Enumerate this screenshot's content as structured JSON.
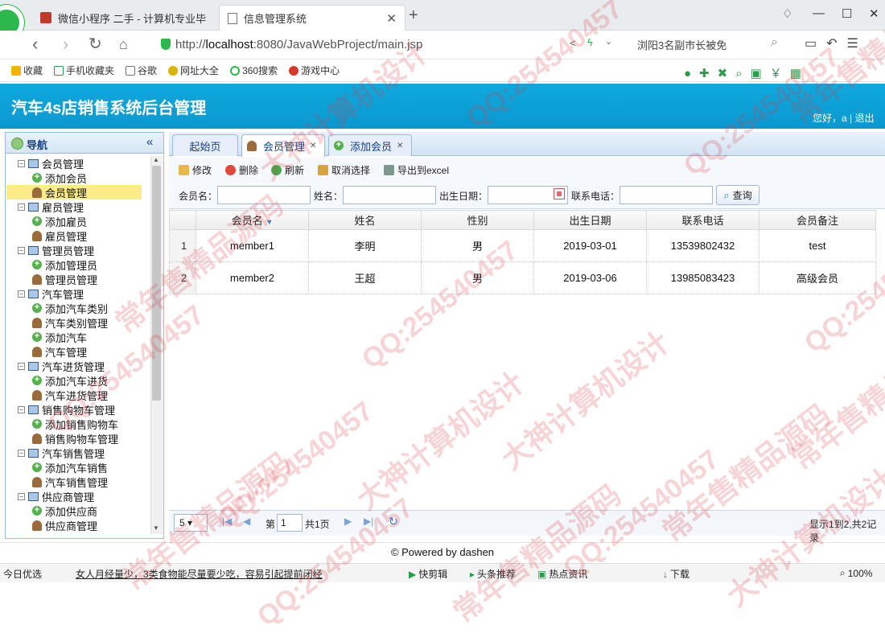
{
  "browser": {
    "tabs": [
      {
        "title": "微信小程序 二手 - 计算机专业毕"
      },
      {
        "title": "信息管理系统"
      }
    ],
    "url_prefix": "http://",
    "url_host": "localhost",
    "url_rest": ":8080/JavaWebProject/main.jsp",
    "news_text": "浏阳3名副市长被免",
    "bookmarks": [
      "收藏",
      "手机收藏夹",
      "谷歌",
      "网址大全",
      "360搜索",
      "游戏中心"
    ]
  },
  "app": {
    "title": "汽车4s店销售系统后台管理",
    "greeting": "您好，a | 退出",
    "accent": "#0fa9de"
  },
  "sidebar": {
    "title": "导航",
    "tree": [
      {
        "type": "parent",
        "label": "会员管理"
      },
      {
        "type": "add",
        "label": "添加会员"
      },
      {
        "type": "manage",
        "label": "会员管理",
        "selected": true
      },
      {
        "type": "parent",
        "label": "雇员管理"
      },
      {
        "type": "add",
        "label": "添加雇员"
      },
      {
        "type": "manage",
        "label": "雇员管理"
      },
      {
        "type": "parent",
        "label": "管理员管理"
      },
      {
        "type": "add",
        "label": "添加管理员"
      },
      {
        "type": "manage",
        "label": "管理员管理"
      },
      {
        "type": "parent",
        "label": "汽车管理"
      },
      {
        "type": "add",
        "label": "添加汽车类别"
      },
      {
        "type": "manage",
        "label": "汽车类别管理"
      },
      {
        "type": "add",
        "label": "添加汽车"
      },
      {
        "type": "manage",
        "label": "汽车管理"
      },
      {
        "type": "parent",
        "label": "汽车进货管理"
      },
      {
        "type": "add",
        "label": "添加汽车进货"
      },
      {
        "type": "manage",
        "label": "汽车进货管理"
      },
      {
        "type": "parent",
        "label": "销售购物车管理"
      },
      {
        "type": "add",
        "label": "添加销售购物车"
      },
      {
        "type": "manage",
        "label": "销售购物车管理"
      },
      {
        "type": "parent",
        "label": "汽车销售管理"
      },
      {
        "type": "add",
        "label": "添加汽车销售"
      },
      {
        "type": "manage",
        "label": "汽车销售管理"
      },
      {
        "type": "parent",
        "label": "供应商管理"
      },
      {
        "type": "add",
        "label": "添加供应商"
      },
      {
        "type": "manage",
        "label": "供应商管理"
      }
    ]
  },
  "tabs": {
    "home": "起始页",
    "member_manage": "会员管理",
    "add_member": "添加会员"
  },
  "toolbar": {
    "edit": "修改",
    "delete": "删除",
    "refresh": "刷新",
    "cancel_select": "取消选择",
    "export": "导出到excel"
  },
  "filters": {
    "member_name": "会员名：",
    "name": "姓名：",
    "birthday": "出生日期：",
    "phone": "联系电话：",
    "query": "查询"
  },
  "grid": {
    "columns": [
      "会员名",
      "姓名",
      "性别",
      "出生日期",
      "联系电话",
      "会员备注"
    ],
    "rows": [
      {
        "num": "1",
        "cells": [
          "member1",
          "李明",
          "男",
          "2019-03-01",
          "13539802432",
          "test"
        ]
      },
      {
        "num": "2",
        "cells": [
          "member2",
          "王超",
          "男",
          "2019-03-06",
          "13985083423",
          "高级会员"
        ]
      }
    ]
  },
  "pager": {
    "page_size": "5 ▾",
    "page_label": "第",
    "page_value": "1",
    "total_pages": "共1页",
    "info": "显示1到2,共2记录"
  },
  "footer": "© Powered by dashen",
  "statusbar": {
    "left": "今日优选",
    "headline": "女人月经量少，3类食物能尽量要少吃，容易引起提前闭经",
    "items": [
      "快剪辑",
      "头条推荐",
      "热点资讯",
      "下载"
    ],
    "zoom": "100%"
  },
  "watermarks": [
    "QQ:254540457",
    "常年售精品源码",
    "大神计算机设计"
  ]
}
